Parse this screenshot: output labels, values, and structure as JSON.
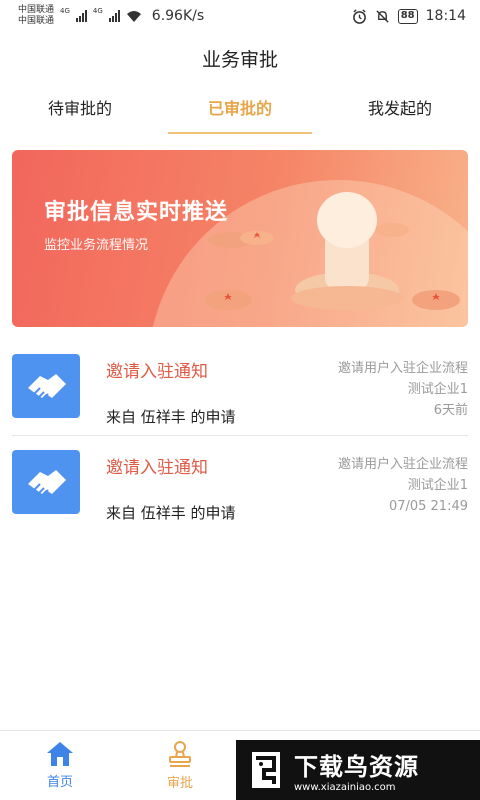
{
  "status_bar": {
    "carrier_1": "中国联通",
    "carrier_2": "中国联通",
    "net_type_1": "4G",
    "net_type_2": "4G",
    "speed": "6.96K/s",
    "battery": "88",
    "time": "18:14"
  },
  "header": {
    "title": "业务审批"
  },
  "tabs": [
    {
      "label": "待审批的"
    },
    {
      "label": "已审批的"
    },
    {
      "label": "我发起的"
    }
  ],
  "banner": {
    "title": "审批信息实时推送",
    "subtitle": "监控业务流程情况"
  },
  "items": [
    {
      "title": "邀请入驻通知",
      "from": "来自 伍祥丰 的申请",
      "flow": "邀请用户入驻企业流程",
      "company": "测试企业1",
      "time": "6天前"
    },
    {
      "title": "邀请入驻通知",
      "from": "来自 伍祥丰 的申请",
      "flow": "邀请用户入驻企业流程",
      "company": "测试企业1",
      "time": "07/05 21:49"
    }
  ],
  "bottom_nav": [
    {
      "label": "首页",
      "icon": "home-icon"
    },
    {
      "label": "审批",
      "icon": "stamp-icon"
    }
  ],
  "watermark": {
    "title": "下载鸟资源",
    "url": "www.xiazainiao.com"
  },
  "colors": {
    "accent_orange": "#e8a54b",
    "title_red": "#e05a46",
    "icon_blue": "#4f93f0",
    "home_blue": "#3e84e6"
  }
}
